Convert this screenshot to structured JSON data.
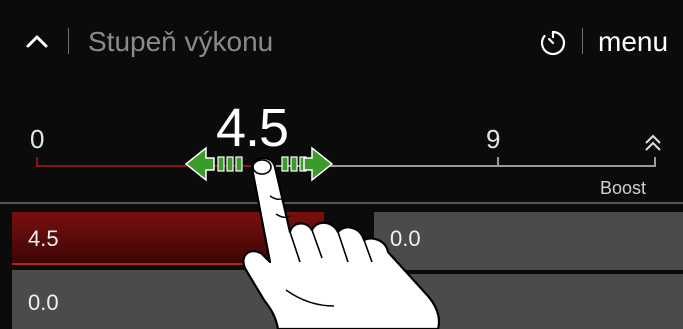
{
  "header": {
    "back_icon": "chevron-up-icon",
    "title": "Stupeň výkonu",
    "timer_icon": "timer-icon",
    "menu_label": "menu"
  },
  "slider": {
    "min_label": "0",
    "max_label": "9",
    "current_value": "4.5",
    "level": 4.5,
    "boost_label": "Boost",
    "boost_icon": "double-chevron-up-icon",
    "colors": {
      "active_track": "#8a1414",
      "inactive_track": "#9a9a9a"
    }
  },
  "zones": [
    {
      "value": "4.5",
      "state": "active"
    },
    {
      "value": "0.0",
      "state": "inactive"
    },
    {
      "value": "0.0",
      "state": "inactive"
    }
  ],
  "gesture": {
    "hand_icon": "touch-hand-icon",
    "arrows_icon": "swipe-left-right-arrows-icon",
    "arrow_color": "#3a9a2a"
  }
}
